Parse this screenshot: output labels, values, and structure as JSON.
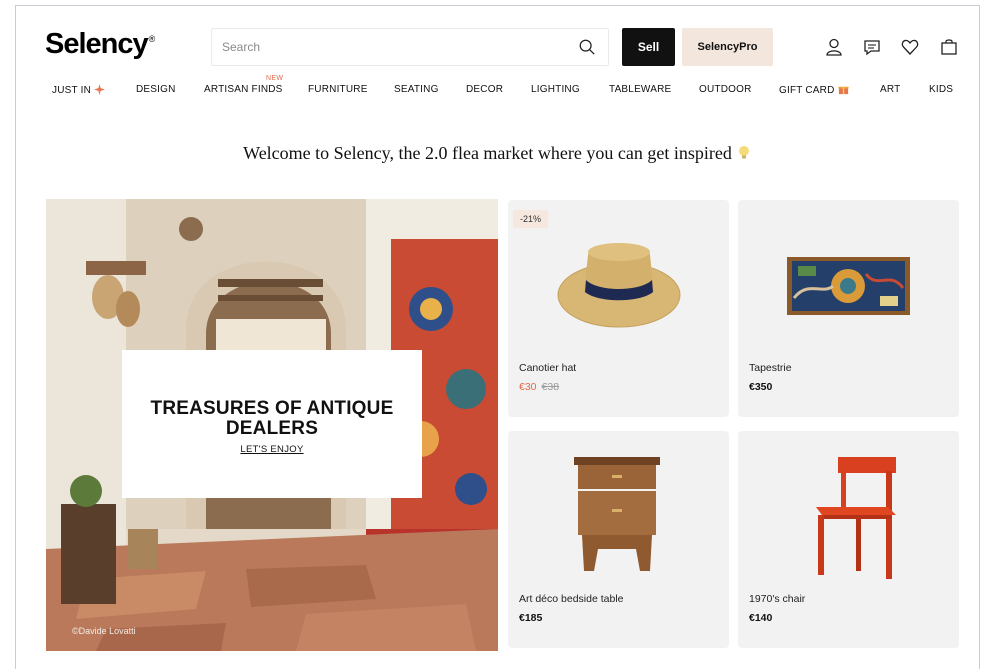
{
  "header": {
    "logo": "Selency",
    "logo_mark": "®",
    "search_placeholder": "Search",
    "sell_label": "Sell",
    "pro_label": "SelencyPro"
  },
  "nav": {
    "items": [
      {
        "label": "JUST IN",
        "emoji": "sparkle"
      },
      {
        "label": "DESIGN"
      },
      {
        "label": "ARTISAN FINDS",
        "tag": "NEW"
      },
      {
        "label": "FURNITURE"
      },
      {
        "label": "SEATING"
      },
      {
        "label": "DECOR"
      },
      {
        "label": "LIGHTING"
      },
      {
        "label": "TABLEWARE"
      },
      {
        "label": "OUTDOOR"
      },
      {
        "label": "GIFT CARD",
        "emoji": "gift"
      },
      {
        "label": "ART"
      },
      {
        "label": "KIDS"
      }
    ]
  },
  "welcome": "Welcome to Selency, the 2.0 flea market where you can get inspired",
  "hero": {
    "title_line1": "TREASURES OF ANTIQUE",
    "title_line2": "DEALERS",
    "link": "LET'S ENJOY",
    "credit": "©Davide Lovatti"
  },
  "products": [
    {
      "name": "Canotier hat",
      "price": "€30",
      "old_price": "€38",
      "badge": "-21%"
    },
    {
      "name": "Tapestrie",
      "price": "€350"
    },
    {
      "name": "Art déco bedside table",
      "price": "€185"
    },
    {
      "name": "1970's chair",
      "price": "€140"
    }
  ],
  "colors": {
    "accent_sale": "#e06a4a",
    "sell_button": "#111111",
    "pro_button": "#f2e6dd",
    "card_bg": "#f2f2f2"
  }
}
